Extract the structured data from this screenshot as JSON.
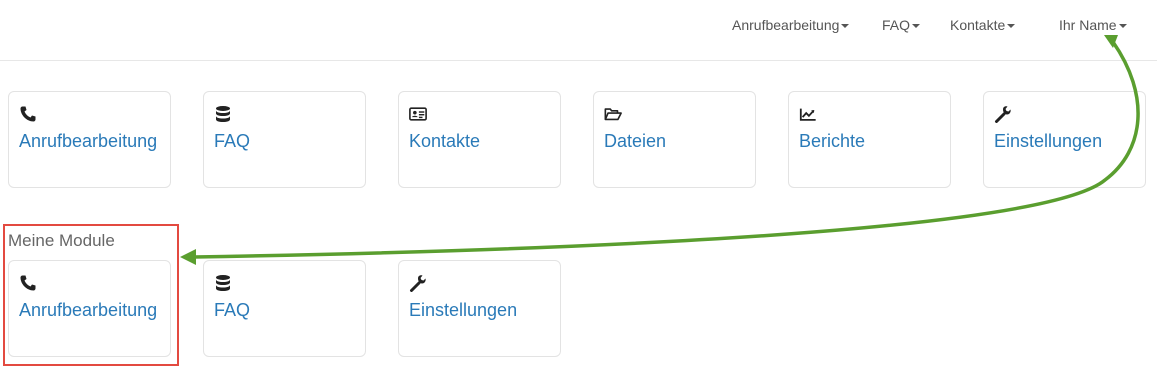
{
  "navbar": {
    "items": [
      {
        "label": "Anrufbearbeitung"
      },
      {
        "label": "FAQ"
      },
      {
        "label": "Kontakte"
      },
      {
        "label": "Ihr Name"
      }
    ]
  },
  "tiles": [
    {
      "label": "Anrufbearbeitung",
      "icon": "phone-icon"
    },
    {
      "label": "FAQ",
      "icon": "database-icon"
    },
    {
      "label": "Kontakte",
      "icon": "contact-card-icon"
    },
    {
      "label": "Dateien",
      "icon": "folder-open-icon"
    },
    {
      "label": "Berichte",
      "icon": "line-chart-icon"
    },
    {
      "label": "Einstellungen",
      "icon": "wrench-icon"
    }
  ],
  "modules": {
    "title": "Meine Module",
    "tiles": [
      {
        "label": "Anrufbearbeitung",
        "icon": "phone-icon"
      },
      {
        "label": "FAQ",
        "icon": "database-icon"
      },
      {
        "label": "Einstellungen",
        "icon": "wrench-icon"
      }
    ]
  },
  "colors": {
    "link": "#2a7ab8",
    "annotation_arrow": "#5a9e2f",
    "annotation_box": "#e34a40"
  }
}
